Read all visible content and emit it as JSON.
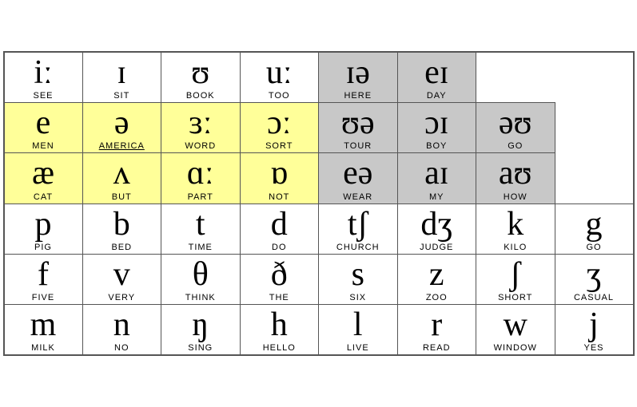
{
  "rows": [
    {
      "type": "vowel1",
      "cells": [
        {
          "symbol": "iː",
          "word": "SEE",
          "bg": "white"
        },
        {
          "symbol": "ɪ",
          "word": "SIT",
          "bg": "white"
        },
        {
          "symbol": "ʊ",
          "word": "BOOK",
          "bg": "white"
        },
        {
          "symbol": "uː",
          "word": "TOO",
          "bg": "white"
        },
        {
          "symbol": "ɪə",
          "word": "HERE",
          "bg": "gray"
        },
        {
          "symbol": "eɪ",
          "word": "DAY",
          "bg": "gray"
        },
        {
          "symbol": "",
          "word": "",
          "bg": "none",
          "empty": true
        }
      ]
    },
    {
      "type": "vowel2",
      "cells": [
        {
          "symbol": "e",
          "word": "MEN",
          "bg": "yellow"
        },
        {
          "symbol": "ə",
          "word": "AMERICA",
          "bg": "yellow",
          "underline": true
        },
        {
          "symbol": "ɜː",
          "word": "WORD",
          "bg": "yellow"
        },
        {
          "symbol": "ɔː",
          "word": "SORT",
          "bg": "yellow"
        },
        {
          "symbol": "ʊə",
          "word": "TOUR",
          "bg": "gray"
        },
        {
          "symbol": "ɔɪ",
          "word": "BOY",
          "bg": "gray"
        },
        {
          "symbol": "əʊ",
          "word": "GO",
          "bg": "gray"
        }
      ]
    },
    {
      "type": "vowel3",
      "cells": [
        {
          "symbol": "æ",
          "word": "CAT",
          "bg": "yellow"
        },
        {
          "symbol": "ʌ",
          "word": "BUT",
          "bg": "yellow"
        },
        {
          "symbol": "ɑː",
          "word": "PART",
          "bg": "yellow"
        },
        {
          "symbol": "ɒ",
          "word": "NOT",
          "bg": "yellow"
        },
        {
          "symbol": "eə",
          "word": "WEAR",
          "bg": "gray"
        },
        {
          "symbol": "aɪ",
          "word": "MY",
          "bg": "gray"
        },
        {
          "symbol": "aʊ",
          "word": "HOW",
          "bg": "gray"
        }
      ]
    },
    {
      "type": "consonant1",
      "cells": [
        {
          "symbol": "p",
          "word": "PIG",
          "bg": "white"
        },
        {
          "symbol": "b",
          "word": "BED",
          "bg": "white"
        },
        {
          "symbol": "t",
          "word": "TIME",
          "bg": "white"
        },
        {
          "symbol": "d",
          "word": "DO",
          "bg": "white"
        },
        {
          "symbol": "tʃ",
          "word": "CHURCH",
          "bg": "white"
        },
        {
          "symbol": "dʒ",
          "word": "JUDGE",
          "bg": "white"
        },
        {
          "symbol": "k",
          "word": "KILO",
          "bg": "white"
        },
        {
          "symbol": "g",
          "word": "GO",
          "bg": "white"
        }
      ]
    },
    {
      "type": "consonant2",
      "cells": [
        {
          "symbol": "f",
          "word": "FIVE",
          "bg": "white"
        },
        {
          "symbol": "v",
          "word": "VERY",
          "bg": "white"
        },
        {
          "symbol": "θ",
          "word": "THINK",
          "bg": "white"
        },
        {
          "symbol": "ð",
          "word": "THE",
          "bg": "white"
        },
        {
          "symbol": "s",
          "word": "SIX",
          "bg": "white"
        },
        {
          "symbol": "z",
          "word": "ZOO",
          "bg": "white"
        },
        {
          "symbol": "ʃ",
          "word": "SHORT",
          "bg": "white"
        },
        {
          "symbol": "ʒ",
          "word": "CASUAL",
          "bg": "white"
        }
      ]
    },
    {
      "type": "consonant3",
      "cells": [
        {
          "symbol": "m",
          "word": "MILK",
          "bg": "white"
        },
        {
          "symbol": "n",
          "word": "NO",
          "bg": "white"
        },
        {
          "symbol": "ŋ",
          "word": "SING",
          "bg": "white"
        },
        {
          "symbol": "h",
          "word": "HELLO",
          "bg": "white"
        },
        {
          "symbol": "l",
          "word": "LIVE",
          "bg": "white"
        },
        {
          "symbol": "r",
          "word": "READ",
          "bg": "white"
        },
        {
          "symbol": "w",
          "word": "WINDOW",
          "bg": "white"
        },
        {
          "symbol": "j",
          "word": "YES",
          "bg": "white"
        }
      ]
    }
  ]
}
